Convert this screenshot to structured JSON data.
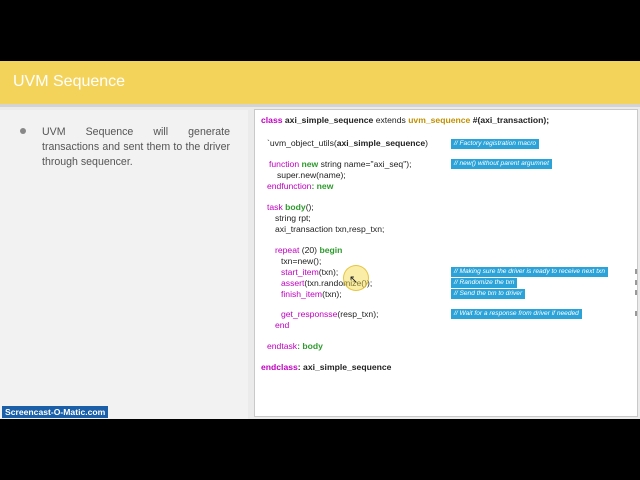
{
  "slide": {
    "title": "UVM Sequence",
    "bullet": "UVM Sequence will generate transactions and sent them to the driver through sequencer."
  },
  "code": {
    "l1_class": "class",
    "l1_name": "axi_simple_sequence",
    "l1_extends": "extends",
    "l1_base": "uvm_sequence",
    "l1_param": "#(axi_transaction);",
    "l2_macro": "`uvm_object_utils(",
    "l2_arg": "axi_simple_sequence",
    "l2_close": ")",
    "l3_kw": "function",
    "l3_new": "new",
    "l3_rest": "string name=\"axi_seq\");",
    "l4": "super.new(name);",
    "l5_kw": "endfunction",
    "l5_new": ": new",
    "l6_task": "task",
    "l6_body": "body",
    "l6_rest": "();",
    "l7": "string rpt;",
    "l8": "axi_transaction txn,resp_txn;",
    "l9_repeat": "repeat",
    "l9_count": "(20)",
    "l9_begin": "begin",
    "l10": "txn=new();",
    "l11_fn": "start_item",
    "l11_rest": "(txn);",
    "l12_fn": "assert",
    "l12_rest": "(txn.randomize());",
    "l13_fn": "finish_item",
    "l13_rest": "(txn);",
    "l14_fn": "get_responsse",
    "l14_rest": "(resp_txn);",
    "l15_end": "end",
    "l16_endtask": "endtask",
    "l16_body": ": body",
    "l17_endclass": "endclass",
    "l17_name": ": axi_simple_sequence"
  },
  "comments": {
    "factory": "//  Factory registration macro",
    "new": "// new() without parent argumnet",
    "ready": "// Making sure the driver is ready to receive next txn",
    "randomize": "// Randomize the txn",
    "send": "//  Send the txn to driver",
    "wait": "//  Wait for a  response from driver if needed"
  },
  "watermark": "Screencast-O-Matic.com",
  "colors": {
    "title_bar": "#f4d35b",
    "keyword": "#c000c0",
    "method": "#2d9a2d",
    "type": "#c09000",
    "comment_bg": "#2ba3d9"
  }
}
